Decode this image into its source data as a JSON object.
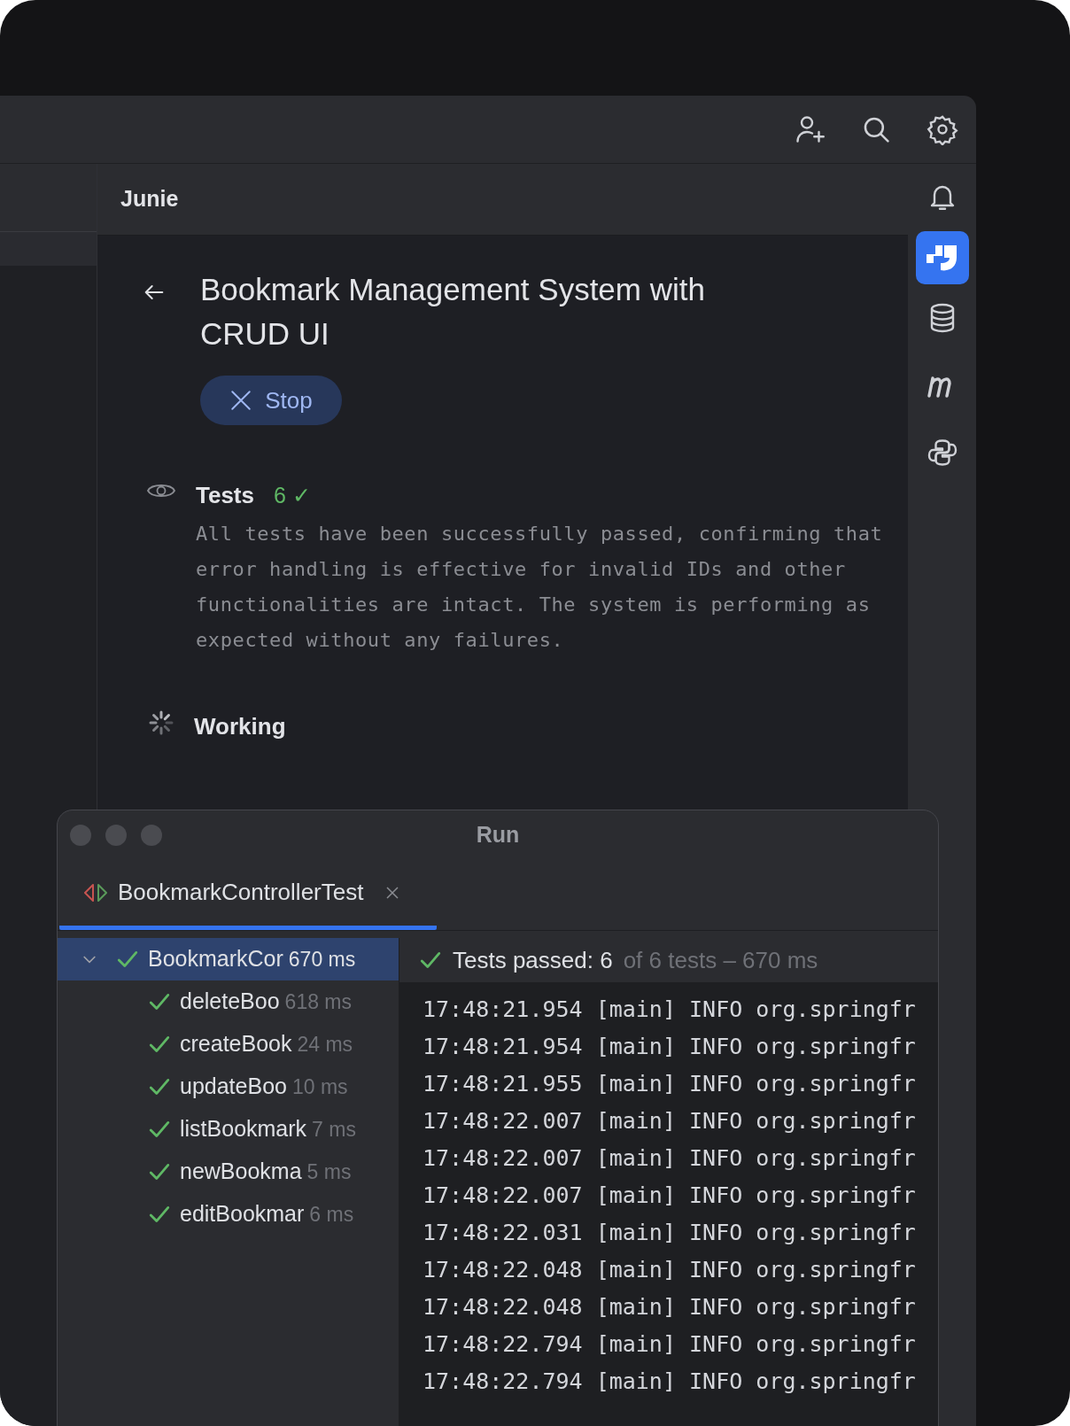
{
  "panel": {
    "title": "Junie"
  },
  "task": {
    "title": "Bookmark Management System with CRUD UI",
    "stop_button": "Stop"
  },
  "steps": [
    {
      "kind": "tests",
      "title": "Tests",
      "count": "6 ✓",
      "text": "All tests have been successfully passed, confirming that error handling is effective for invalid IDs and other functionalities are intact. The system is performing as expected without any failures."
    },
    {
      "kind": "working",
      "title": "Working"
    }
  ],
  "run_window": {
    "title": "Run",
    "tab": {
      "label": "BookmarkControllerTest",
      "selected": true
    },
    "tree": [
      {
        "name": "BookmarkCor",
        "time": "670 ms",
        "selected": true,
        "expanded": true,
        "children": [
          {
            "name": "deleteBoo",
            "time": "618 ms",
            "selected": false
          },
          {
            "name": "createBook",
            "time": "24 ms",
            "selected": false
          },
          {
            "name": "updateBoo",
            "time": "10 ms",
            "selected": false
          },
          {
            "name": "listBookmark",
            "time": "7 ms",
            "selected": false
          },
          {
            "name": "newBookma",
            "time": "5 ms",
            "selected": false
          },
          {
            "name": "editBookmar",
            "time": "6 ms",
            "selected": false
          }
        ]
      }
    ],
    "summary": {
      "passed": "Tests passed: 6",
      "detail": "of 6 tests – 670 ms"
    },
    "log": [
      "17:48:21.954 [main] INFO org.springfr",
      "17:48:21.954 [main] INFO org.springfr",
      "17:48:21.955 [main] INFO org.springfr",
      "17:48:22.007 [main] INFO org.springfr",
      "17:48:22.007 [main] INFO org.springfr",
      "17:48:22.007 [main] INFO org.springfr",
      "17:48:22.031 [main] INFO org.springfr",
      "17:48:22.048 [main] INFO org.springfr",
      "17:48:22.048 [main] INFO org.springfr",
      "17:48:22.794 [main] INFO org.springfr",
      "17:48:22.794 [main] INFO org.springfr"
    ]
  }
}
